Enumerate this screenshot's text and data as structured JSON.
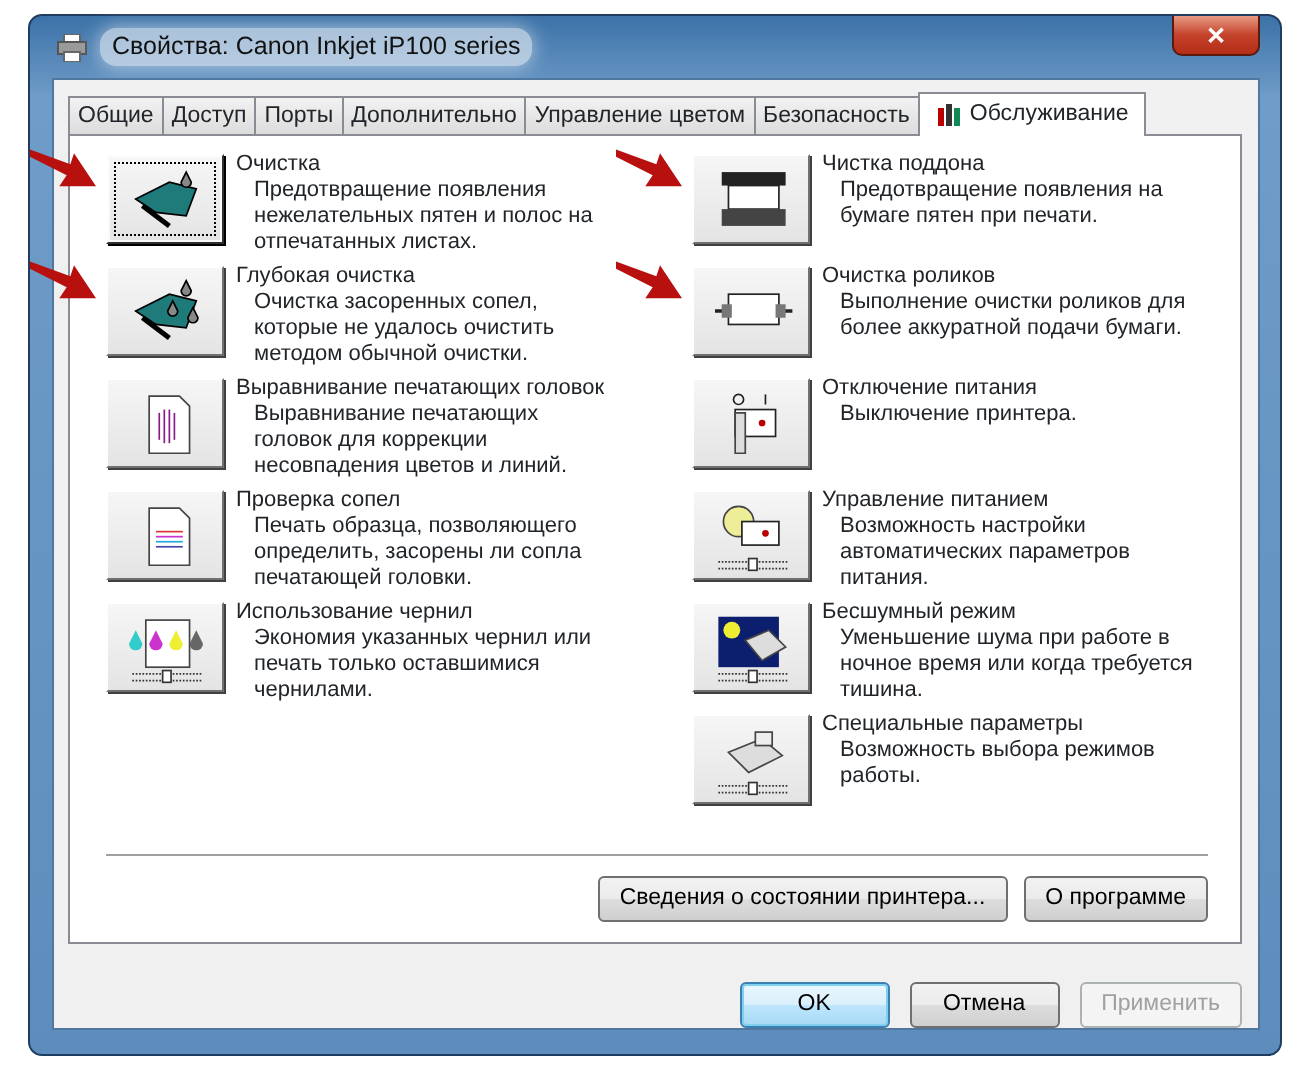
{
  "window": {
    "title": "Свойства: Canon Inkjet iP100 series",
    "close": "✕"
  },
  "tabs": [
    {
      "label": "Общие",
      "selected": false
    },
    {
      "label": "Доступ",
      "selected": false
    },
    {
      "label": "Порты",
      "selected": false
    },
    {
      "label": "Дополнительно",
      "selected": false
    },
    {
      "label": "Управление цветом",
      "selected": false
    },
    {
      "label": "Безопасность",
      "selected": false
    },
    {
      "label": "Обслуживание",
      "selected": true
    }
  ],
  "left_items": [
    {
      "title": "Очистка",
      "description": "Предотвращение появления нежелательных пятен и полос на отпечатанных листах.",
      "focused": true,
      "marked": true
    },
    {
      "title": "Глубокая очистка",
      "description": "Очистка засоренных сопел, которые не удалось очистить методом обычной очистки.",
      "focused": false,
      "marked": true
    },
    {
      "title": "Выравнивание печатающих головок",
      "description": "Выравнивание печатающих головок для коррекции несовпадения цветов и линий.",
      "focused": false,
      "marked": false
    },
    {
      "title": "Проверка сопел",
      "description": "Печать образца, позволяющего определить, засорены ли сопла печатающей головки.",
      "focused": false,
      "marked": false
    },
    {
      "title": "Использование чернил",
      "description": "Экономия указанных чернил или печать только оставшимися чернилами.",
      "focused": false,
      "marked": false
    }
  ],
  "right_items": [
    {
      "title": "Чистка поддона",
      "description": "Предотвращение появления на бумаге пятен при печати.",
      "focused": false,
      "marked": true
    },
    {
      "title": "Очистка роликов",
      "description": "Выполнение очистки роликов для более аккуратной подачи бумаги.",
      "focused": false,
      "marked": true
    },
    {
      "title": "Отключение питания",
      "description": "Выключение принтера.",
      "focused": false,
      "marked": false
    },
    {
      "title": "Управление питанием",
      "description": "Возможность настройки автоматических параметров питания.",
      "focused": false,
      "marked": false
    },
    {
      "title": "Бесшумный режим",
      "description": "Уменьшение шума при работе в ночное время или когда требуется тишина.",
      "focused": false,
      "marked": false
    },
    {
      "title": "Специальные параметры",
      "description": "Возможность выбора режимов работы.",
      "focused": false,
      "marked": false
    }
  ],
  "panel_buttons": [
    {
      "label": "Сведения о состоянии принтера..."
    },
    {
      "label": "О программе"
    }
  ],
  "dialog_buttons": [
    {
      "label": "OK",
      "default": true,
      "disabled": false
    },
    {
      "label": "Отмена",
      "default": false,
      "disabled": false
    },
    {
      "label": "Применить",
      "default": false,
      "disabled": true
    }
  ]
}
